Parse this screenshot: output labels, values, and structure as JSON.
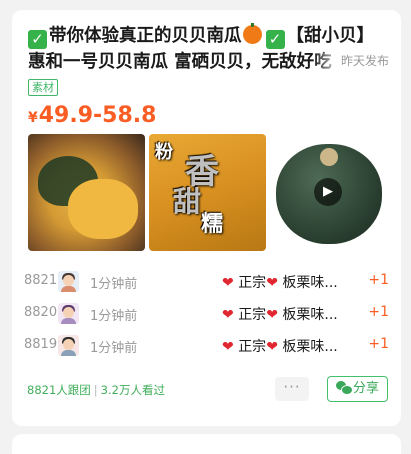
{
  "post": {
    "title_part1": "带你体验真正的贝贝南瓜",
    "title_part2": "【甜小贝】惠和一号贝贝南瓜 富硒贝贝，无敌好吃",
    "published": "昨天发布",
    "tag": "素材",
    "price_symbol": "¥",
    "price": "49.9-58.8"
  },
  "photos": {
    "photo2_text1": "粉",
    "photo2_text2": "香",
    "photo2_text3": "甜",
    "photo2_text4": "糯"
  },
  "orders": [
    {
      "number": "8821",
      "time": "1分钟前",
      "text": "正宗",
      "text2": "板栗味...",
      "qty": "+1"
    },
    {
      "number": "8820",
      "time": "1分钟前",
      "text": "正宗",
      "text2": "板栗味...",
      "qty": "+1"
    },
    {
      "number": "8819",
      "time": "1分钟前",
      "text": "正宗",
      "text2": "板栗味...",
      "qty": "+1"
    }
  ],
  "footer": {
    "group_count": "8821人跟团",
    "views": "3.2万人看过",
    "more": "···",
    "share": "分享"
  }
}
